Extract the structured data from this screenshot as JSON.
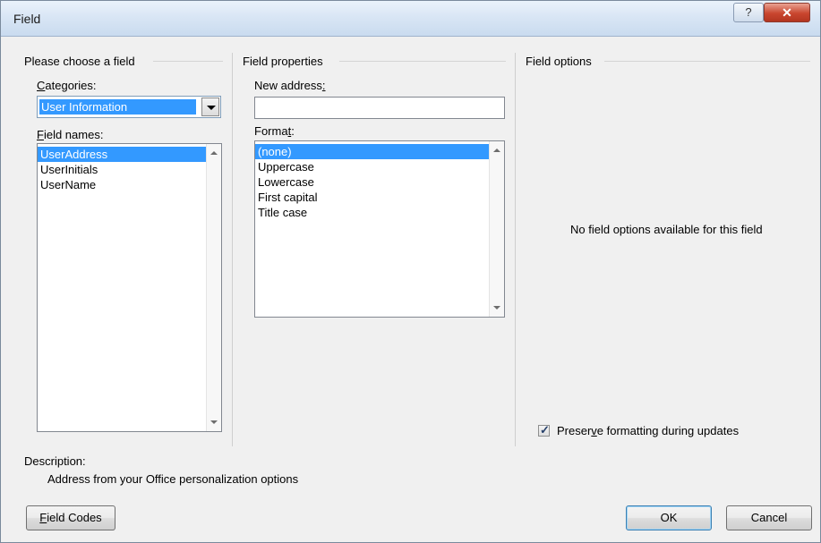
{
  "window": {
    "title": "Field",
    "help_glyph": "?",
    "close_glyph": "✕"
  },
  "choose": {
    "group_title": "Please choose a field",
    "categories_label": "Categories:",
    "categories_selected": "User Information",
    "field_names_label": "Field names:",
    "field_names": [
      {
        "label": "UserAddress",
        "selected": true
      },
      {
        "label": "UserInitials",
        "selected": false
      },
      {
        "label": "UserName",
        "selected": false
      }
    ]
  },
  "properties": {
    "group_title": "Field properties",
    "new_address_label": "New address:",
    "new_address_value": "",
    "format_label": "Format:",
    "formats": [
      {
        "label": "(none)",
        "selected": true
      },
      {
        "label": "Uppercase",
        "selected": false
      },
      {
        "label": "Lowercase",
        "selected": false
      },
      {
        "label": "First capital",
        "selected": false
      },
      {
        "label": "Title case",
        "selected": false
      }
    ]
  },
  "options": {
    "group_title": "Field options",
    "message": "No field options available for this field",
    "preserve_label": "Preserve formatting during updates",
    "preserve_checked": true
  },
  "description": {
    "label": "Description:",
    "text": "Address from your Office personalization options"
  },
  "buttons": {
    "field_codes": "Field Codes",
    "ok": "OK",
    "cancel": "Cancel"
  },
  "colors": {
    "selection": "#3399ff",
    "dialog_bg": "#f0f0f0"
  }
}
